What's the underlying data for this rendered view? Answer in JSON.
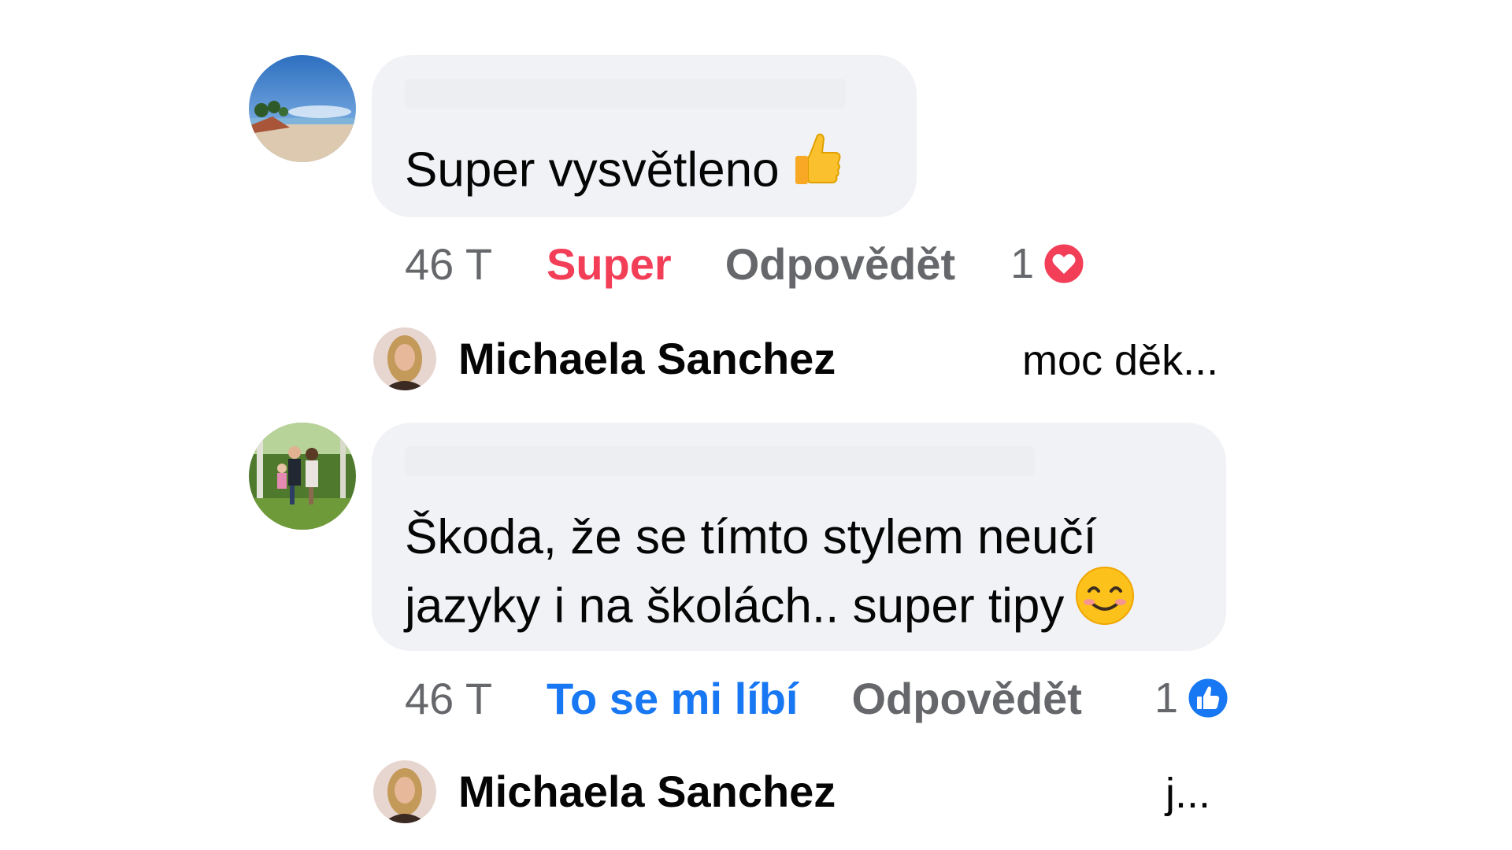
{
  "comments": [
    {
      "text": "Super vysvětleno",
      "emoji": "thumbs-up-emoji",
      "time": "46 T",
      "reaction_action": "Super",
      "reply_action": "Odpovědět",
      "reaction_count": "1",
      "reaction_type": "love-icon",
      "reaction_color": "#f33e58",
      "reply_preview": {
        "author": "Michaela Sanchez",
        "snippet": "moc děk..."
      }
    },
    {
      "text": "Škoda, že se tímto stylem neučí jazyky i na školách.. super tipy",
      "emoji": "smiling-face-emoji",
      "time": "46 T",
      "reaction_action": "To se mi líbí",
      "reply_action": "Odpovědět",
      "reaction_count": "1",
      "reaction_type": "like-icon",
      "reaction_color": "#1877f2",
      "reply_preview": {
        "author": "Michaela Sanchez",
        "snippet": "j..."
      }
    }
  ],
  "colors": {
    "bubble": "#f0f2f5",
    "secondary_text": "#65676b",
    "love": "#f33e58",
    "like": "#1877f2"
  }
}
